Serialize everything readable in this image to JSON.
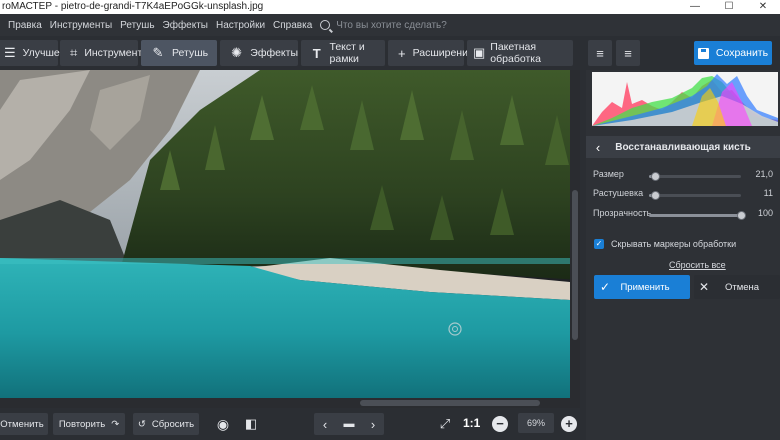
{
  "window": {
    "title": "roМАСТЕР - pietro-de-grandi-T7K4aEPoGGk-unsplash.jpg",
    "controls": [
      "—",
      "☐",
      "✕"
    ]
  },
  "menu": {
    "items": [
      "Правка",
      "Инструменты",
      "Ретушь",
      "Эффекты",
      "Настройки",
      "Справка"
    ],
    "search_placeholder": "Что вы хотите сделать?"
  },
  "toolbar": {
    "tabs": [
      {
        "label": "Улучшения",
        "icon": "sliders-icon"
      },
      {
        "label": "Инструменты",
        "icon": "crop-icon"
      },
      {
        "label": "Ретушь",
        "icon": "brush-icon"
      },
      {
        "label": "Эффекты",
        "icon": "sparkle-icon"
      },
      {
        "label": "Текст и рамки",
        "icon": "text-icon"
      },
      {
        "label": "Расширения",
        "icon": "plus-icon"
      },
      {
        "label": "Пакетная обработка",
        "icon": "images-icon"
      }
    ],
    "save_label": "Сохранить"
  },
  "panel": {
    "title": "Восстанавливающая кисть",
    "sliders": [
      {
        "label": "Размер",
        "value": "21,0",
        "level": 0.07
      },
      {
        "label": "Растушевка",
        "value": "11",
        "level": 0.07
      },
      {
        "label": "Прозрачность",
        "value": "100",
        "level": 1.0
      }
    ],
    "checkbox_label": "Скрывать маркеры обработки",
    "checkbox_checked": true,
    "reset_label": "Сбросить все",
    "apply_label": "Применить",
    "cancel_label": "Отмена"
  },
  "bottom": {
    "undo_label": "Отменить",
    "redo_label": "Повторить",
    "reset_label": "Сбросить",
    "ratio_label": "1:1",
    "zoom_value": "69%"
  }
}
